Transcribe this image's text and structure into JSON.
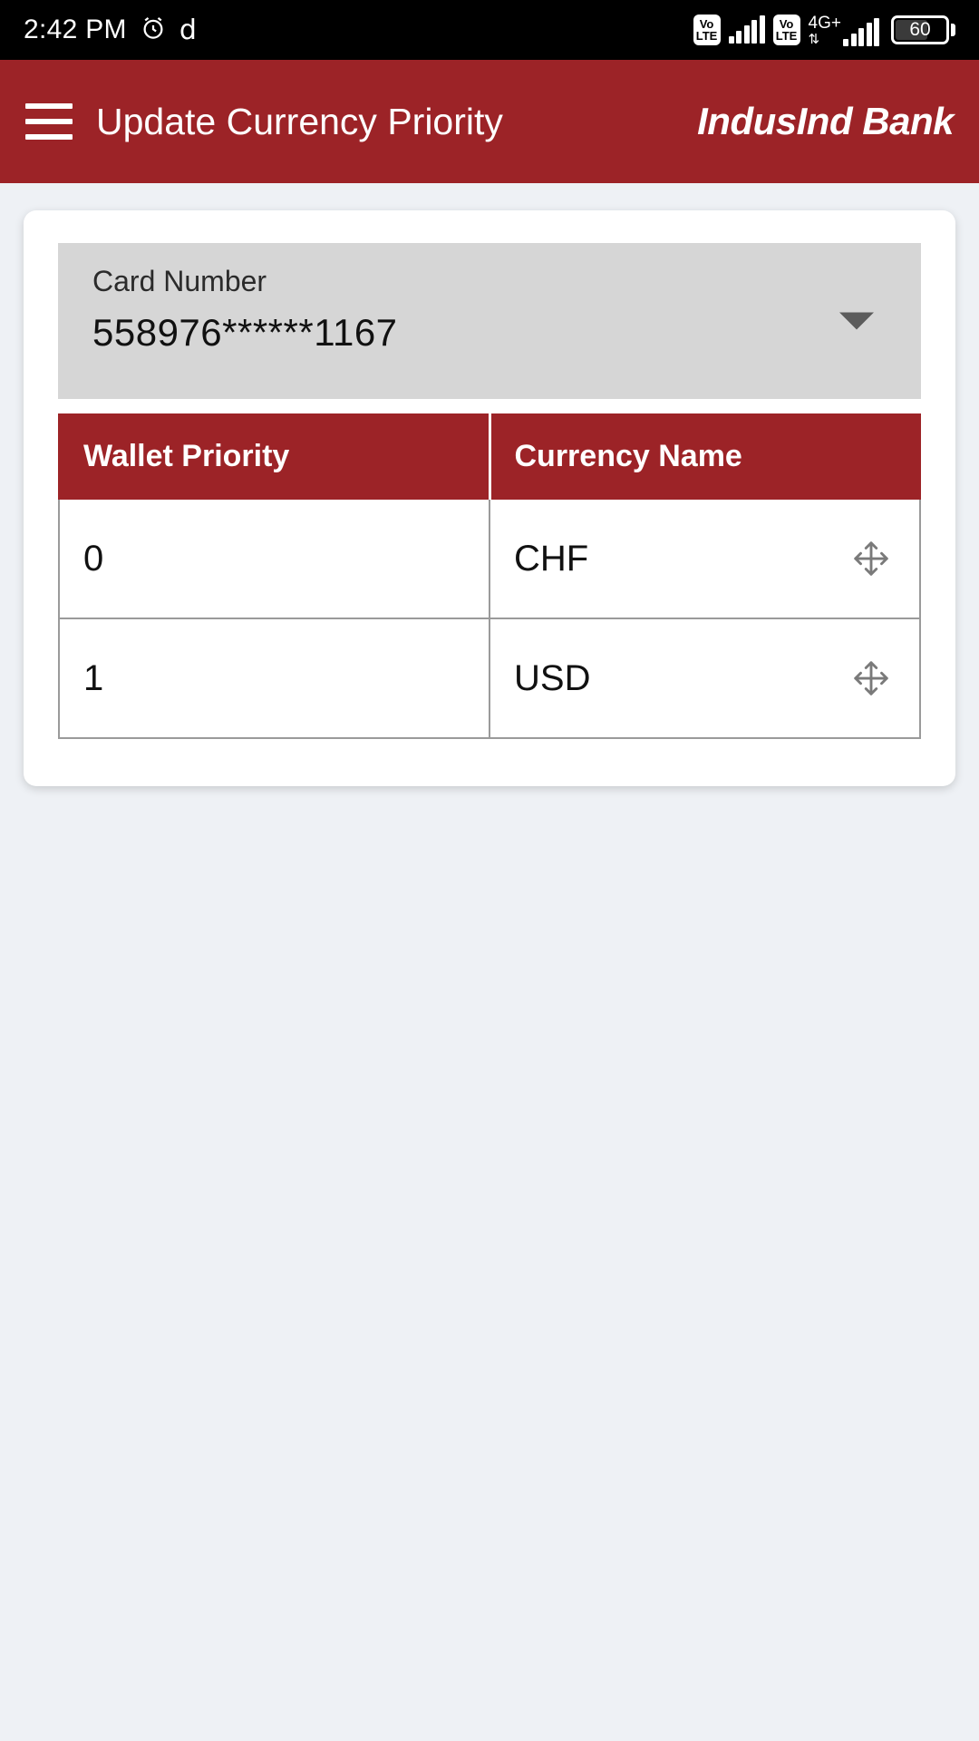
{
  "status_bar": {
    "time": "2:42 PM",
    "alarm_icon": "alarm-clock-icon",
    "extra_glyph": "d",
    "sim1_network_badge": "VoLTE",
    "sim2_network_badge": "VoLTE",
    "network_type": "4G+",
    "data_arrows": "⇅",
    "battery_level": "60"
  },
  "app_bar": {
    "menu_icon": "hamburger-menu-icon",
    "title": "Update Currency Priority",
    "brand": "IndusInd Bank",
    "background_color": "#9c2327"
  },
  "card_selector": {
    "label": "Card Number",
    "value": "558976******1167",
    "caret_icon": "chevron-down-icon"
  },
  "priority_table": {
    "columns": [
      "Wallet Priority",
      "Currency Name"
    ],
    "rows": [
      {
        "priority": "0",
        "currency": "CHF",
        "handle_icon": "move-arrows-icon"
      },
      {
        "priority": "1",
        "currency": "USD",
        "handle_icon": "move-arrows-icon"
      }
    ]
  },
  "colors": {
    "brand_red": "#9c2327",
    "page_background": "#eef1f5",
    "field_background": "#d6d6d6"
  }
}
